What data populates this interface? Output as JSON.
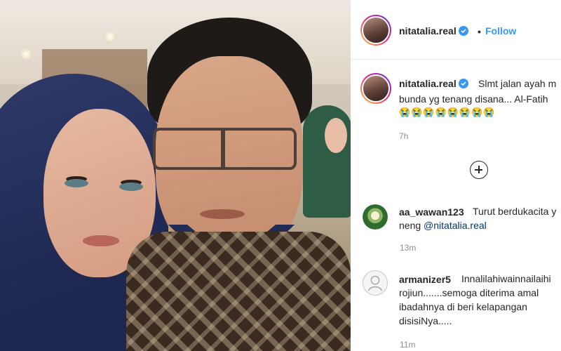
{
  "post": {
    "author": "nitatalia.real",
    "follow_label": "Follow",
    "separator": "•",
    "caption_part1": "Slmt jalan ayah m",
    "caption_line2": "bunda yg tenang disana... Al-Fatih",
    "caption_emoji": "😭😭😭😭😭😭😭😭",
    "caption_time": "7h"
  },
  "comments": [
    {
      "username": "aa_wawan123",
      "text_line1": "Turut berdukacita y",
      "text_line2_prefix": "neng",
      "mention": "@nitatalia.real",
      "time": "13m",
      "avatar": "flower-avatar"
    },
    {
      "username": "armanizer5",
      "text_line1": "Innalilahiwainnailaihi",
      "text_line2": "rojiun.......semoga diterima amal",
      "text_line3": "ibadahnya di beri kelapangan",
      "text_line4": "disisiNya.....",
      "time": "11m",
      "avatar": "default-avatar-icon"
    }
  ],
  "icons": {
    "verified": "verified-badge-icon",
    "more_comments": "plus-circle-icon"
  },
  "colors": {
    "link_blue": "#3897f0",
    "mention": "#00376b",
    "muted": "#8e8e8e"
  }
}
